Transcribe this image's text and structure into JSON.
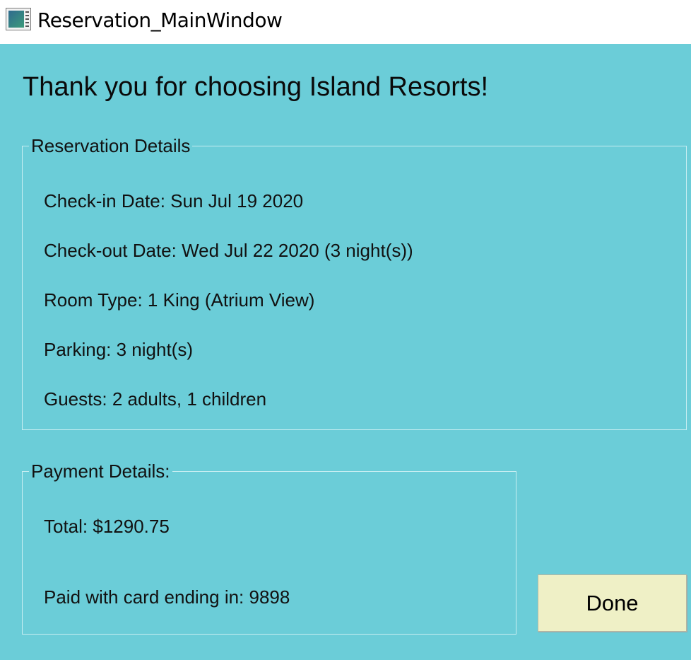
{
  "window": {
    "title": "Reservation_MainWindow",
    "icon": "app-window-icon"
  },
  "heading": "Thank you for choosing Island Resorts!",
  "reservation": {
    "legend": "Reservation Details",
    "check_in": "Check-in Date: Sun Jul 19 2020",
    "check_out": "Check-out Date: Wed Jul 22 2020 (3 night(s))",
    "room_type": "Room Type: 1 King (Atrium View)",
    "parking": "Parking: 3 night(s)",
    "guests": "Guests: 2 adults, 1 children"
  },
  "payment": {
    "legend": "Payment Details:",
    "total": "Total: $1290.75",
    "card": "Paid with card ending in: 9898"
  },
  "actions": {
    "done_label": "Done"
  },
  "colors": {
    "background": "#6bcdd8",
    "button": "#eff0c6",
    "titlebar": "#ffffff"
  }
}
